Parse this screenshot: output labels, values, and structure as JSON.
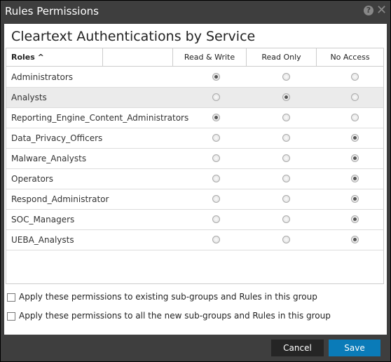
{
  "dialog": {
    "title": "Rules Permissions",
    "heading": "Cleartext Authentications by Service"
  },
  "table": {
    "headers": {
      "roles": "Roles",
      "sort_icon": "^",
      "read_write": "Read & Write",
      "read_only": "Read Only",
      "no_access": "No Access"
    },
    "rows": [
      {
        "role": "Administrators",
        "permission": "read_write"
      },
      {
        "role": "Analysts",
        "permission": "read_only"
      },
      {
        "role": "Reporting_Engine_Content_Administrators",
        "permission": "read_write"
      },
      {
        "role": "Data_Privacy_Officers",
        "permission": "no_access"
      },
      {
        "role": "Malware_Analysts",
        "permission": "no_access"
      },
      {
        "role": "Operators",
        "permission": "no_access"
      },
      {
        "role": "Respond_Administrator",
        "permission": "no_access"
      },
      {
        "role": "SOC_Managers",
        "permission": "no_access"
      },
      {
        "role": "UEBA_Analysts",
        "permission": "no_access"
      }
    ]
  },
  "options": [
    {
      "label": "Apply these permissions to existing sub-groups and Rules in this group",
      "checked": false
    },
    {
      "label": "Apply these permissions to all the new sub-groups and Rules in this group",
      "checked": false
    }
  ],
  "buttons": {
    "cancel": "Cancel",
    "save": "Save"
  },
  "colors": {
    "save": "#0a7bb8",
    "cancel": "#252525",
    "frame": "#3e3e3e"
  }
}
